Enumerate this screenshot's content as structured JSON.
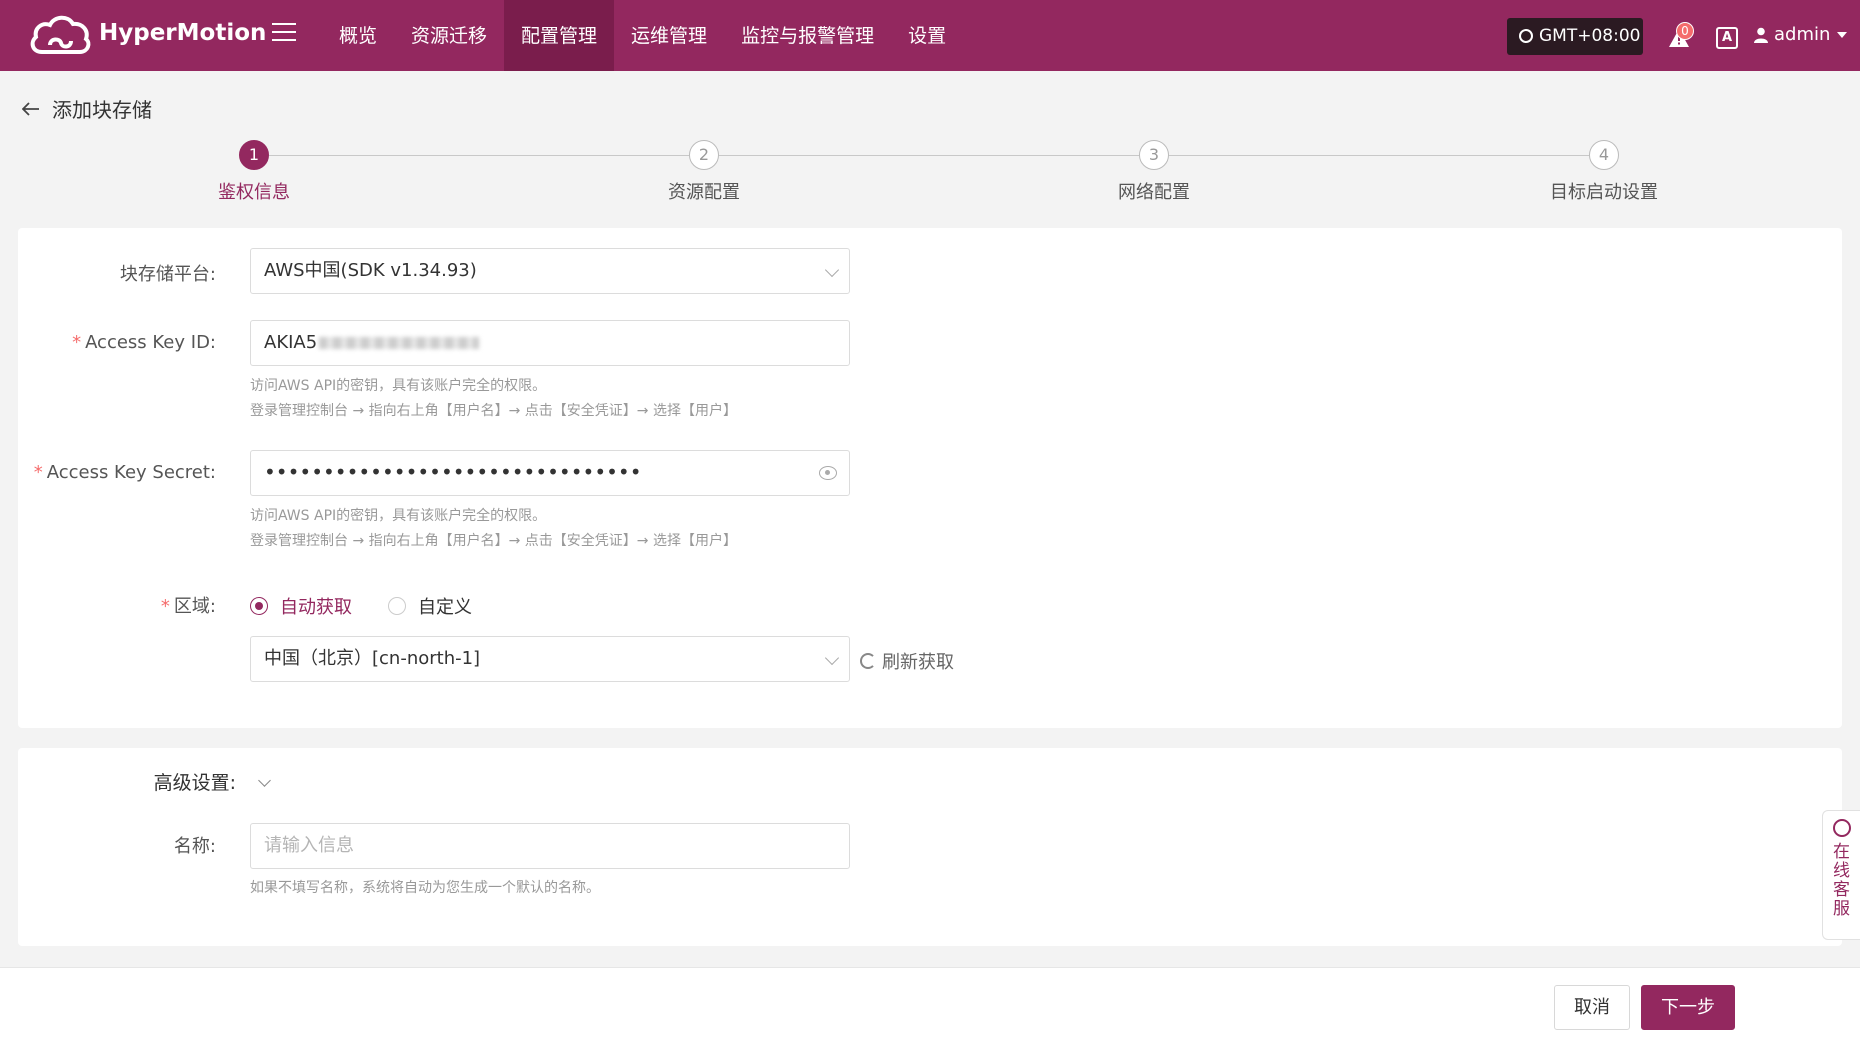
{
  "topbar": {
    "brand": "HyperMotion",
    "nav": [
      "概览",
      "资源迁移",
      "配置管理",
      "运维管理",
      "监控与报警管理",
      "设置"
    ],
    "active_nav_index": 2,
    "timezone": "GMT+08:00",
    "alert_count": "0",
    "lang_icon": "A",
    "user": "admin",
    "color": "#93285f"
  },
  "page": {
    "back_title": "添加块存储"
  },
  "steps": [
    {
      "num": "1",
      "label": "鉴权信息",
      "active": true
    },
    {
      "num": "2",
      "label": "资源配置",
      "active": false
    },
    {
      "num": "3",
      "label": "网络配置",
      "active": false
    },
    {
      "num": "4",
      "label": "目标启动设置",
      "active": false
    }
  ],
  "form": {
    "platform": {
      "label": "块存储平台:",
      "value": "AWS中国(SDK v1.34.93)"
    },
    "access_key_id": {
      "label": "Access Key ID:",
      "value": "AKIA5",
      "required": "*",
      "hint1": "访问AWS API的密钥，具有该账户完全的权限。",
      "hint2": "登录管理控制台 → 指向右上角【用户名】→ 点击【安全凭证】→ 选择【用户】"
    },
    "access_key_secret": {
      "label": "Access Key Secret:",
      "value": "••••••••••••••••••••••••••••••••",
      "required": "*",
      "hint1": "访问AWS API的密钥，具有该账户完全的权限。",
      "hint2": "登录管理控制台 → 指向右上角【用户名】→ 点击【安全凭证】→ 选择【用户】"
    },
    "region": {
      "label": "区域:",
      "required": "*",
      "option_auto": "自动获取",
      "option_custom": "自定义",
      "selected": "自动获取",
      "value": "中国（北京）[cn-north-1]",
      "refresh": "刷新获取"
    }
  },
  "advanced": {
    "title": "高级设置:",
    "name_label": "名称:",
    "name_placeholder": "请输入信息",
    "name_hint": "如果不填写名称，系统将自动为您生成一个默认的名称。"
  },
  "footer": {
    "cancel": "取消",
    "next": "下一步"
  },
  "service": {
    "chars": [
      "在",
      "线",
      "客",
      "服"
    ]
  }
}
